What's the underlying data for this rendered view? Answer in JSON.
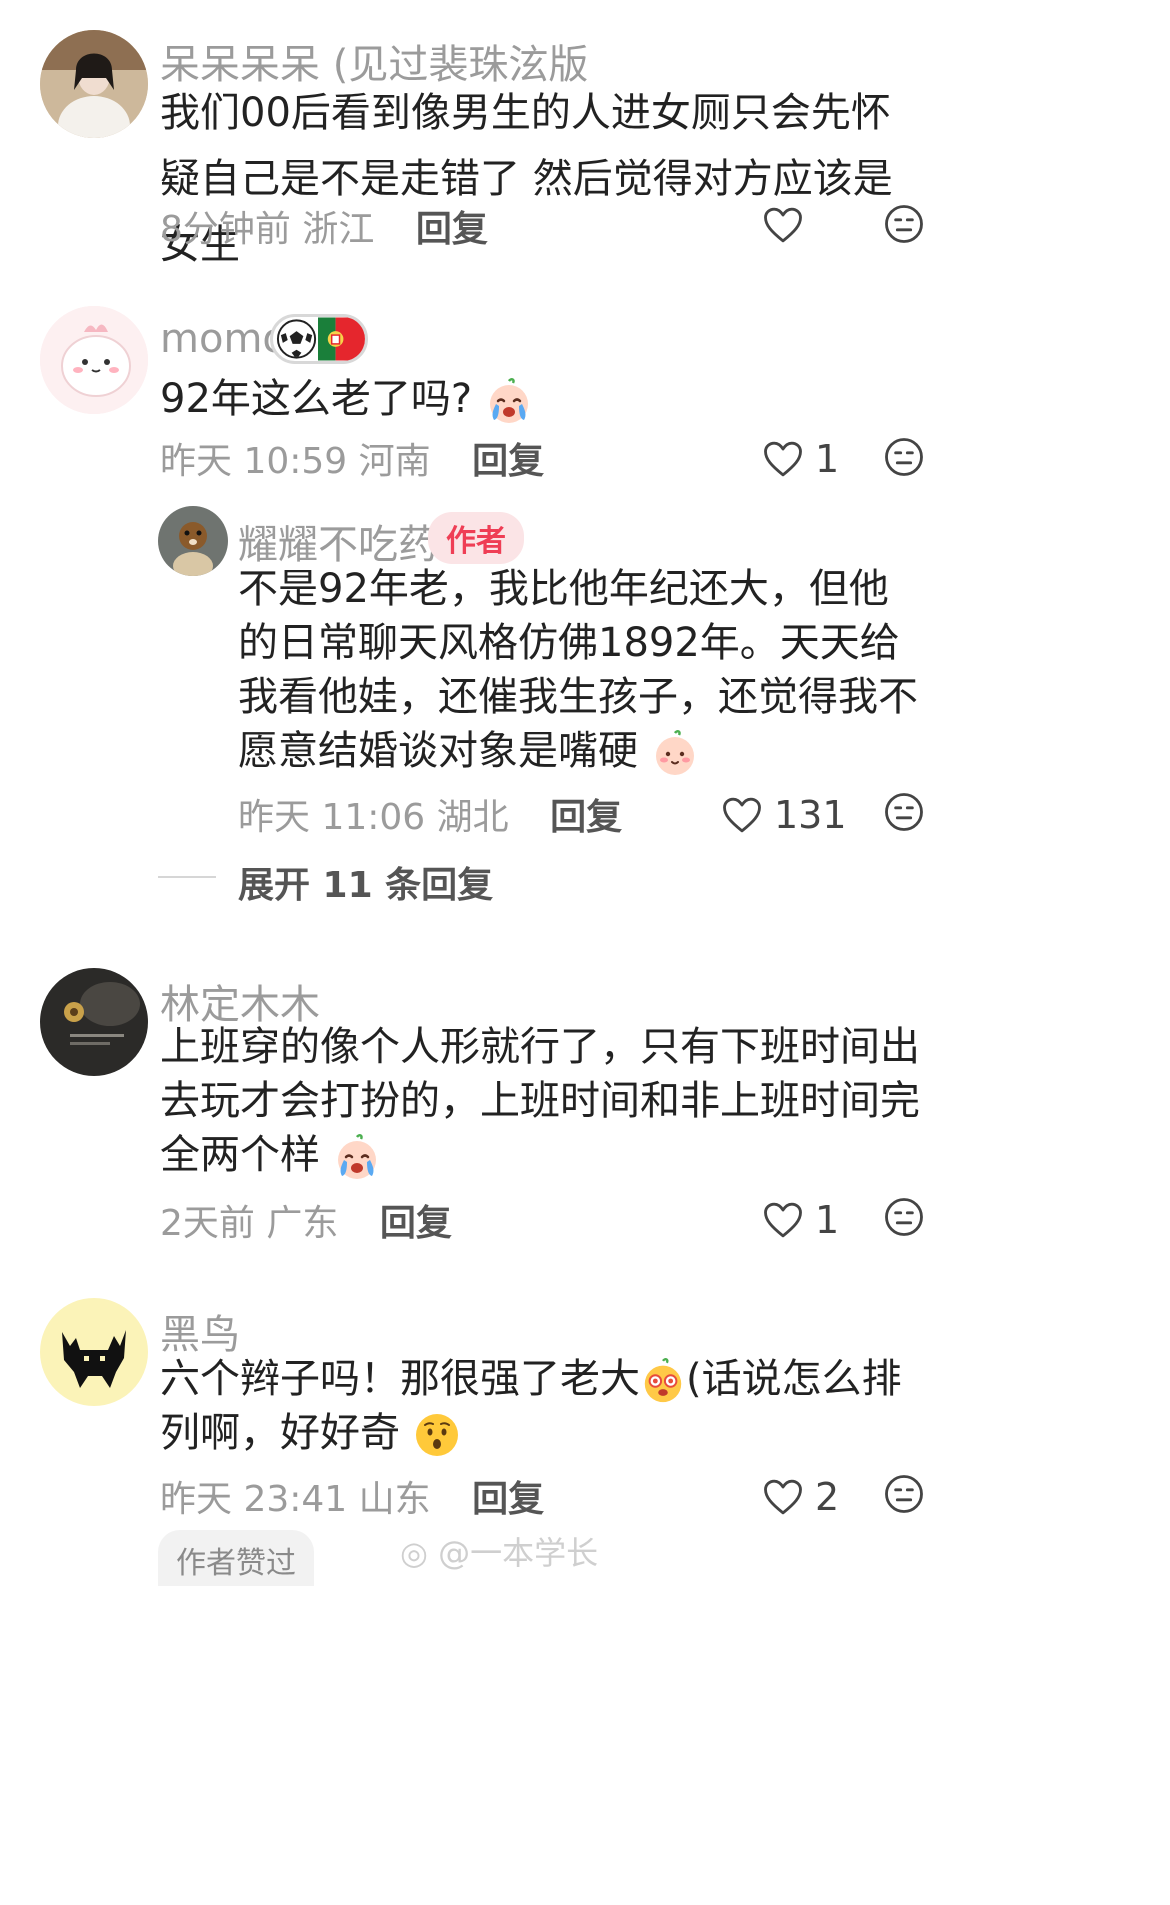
{
  "comments": [
    {
      "username": "呆呆呆呆 (见过裴珠泫版",
      "text": "我们00后看到像男生的人进女厕只会先怀疑自己是不是走错了 然后觉得对方应该是女生",
      "time": "8分钟前",
      "location": "浙江",
      "reply": "回复",
      "likes": ""
    },
    {
      "username": "momo",
      "text": "92年这么老了吗?",
      "time": "昨天 10:59",
      "location": "河南",
      "reply": "回复",
      "likes": "1"
    },
    {
      "username": "林定木木",
      "text": "上班穿的像个人形就行了，只有下班时间出去玩才会打扮的，上班时间和非上班时间完全两个样",
      "time": "2天前",
      "location": "广东",
      "reply": "回复",
      "likes": "1"
    },
    {
      "username": "黑鸟",
      "text_a": "六个辫子吗！那很强了老大",
      "text_b": "(话说怎么排列啊，好好奇",
      "time": "昨天 23:41",
      "location": "山东",
      "reply": "回复",
      "likes": "2",
      "liked_tag": "作者赞过"
    }
  ],
  "sub_reply": {
    "username": "耀耀不吃药",
    "badge": "作者",
    "text": "不是92年老，我比他年纪还大，但他的日常聊天风格仿佛1892年。天天给我看他娃，还催我生孩子，还觉得我不愿意结婚谈对象是嘴硬",
    "time": "昨天 11:06",
    "location": "湖北",
    "reply": "回复",
    "likes": "131"
  },
  "expand_replies": "展开 11 条回复",
  "watermark": "@一本学长",
  "icons": {
    "like": "heart-outline-icon",
    "dislike": "neutral-face-icon",
    "crying": "crying-face-emoji",
    "blush": "smiling-face-emoji",
    "star_eyes": "star-eyes-face-emoji",
    "surprised": "surprised-face-emoji",
    "football": "soccer-ball-icon",
    "flag": "portugal-flag-icon"
  },
  "colors": {
    "author_badge_bg": "#fbe4e6",
    "author_badge_text": "#ef3e55",
    "meta_gray": "#9b9b9b"
  }
}
